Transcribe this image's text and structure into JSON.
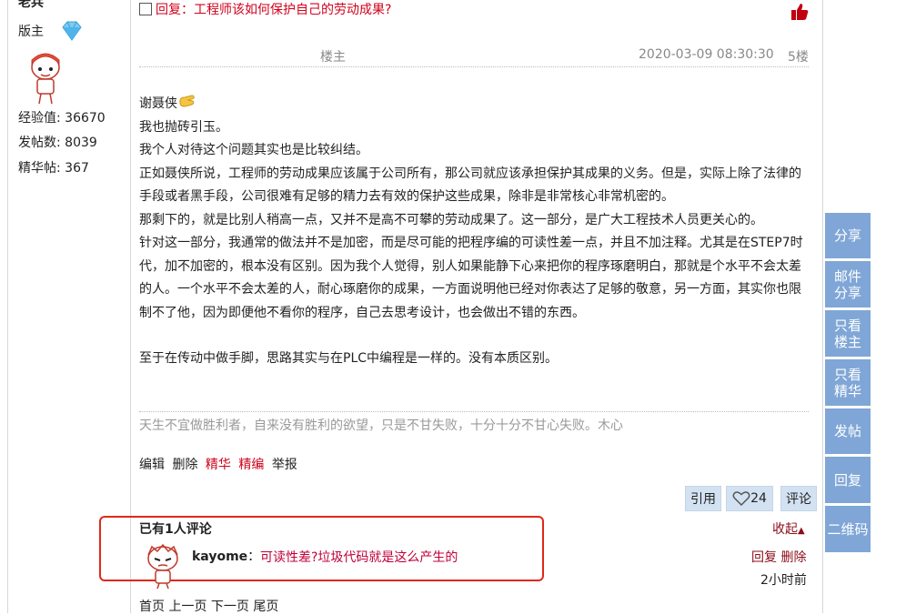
{
  "user": {
    "name": "老兵",
    "role": "版主",
    "stats": [
      {
        "label": "经验值: 36670"
      },
      {
        "label": "发帖数: 8039"
      },
      {
        "label": "精华帖: 367"
      }
    ]
  },
  "post": {
    "title": "回复：工程师该如何保护自己的劳动成果?",
    "author_tag": "楼主",
    "date": "2020-03-09 08:30:30",
    "floor": "5楼",
    "paragraphs": [
      "谢聂侠",
      "我也抛砖引玉。",
      "我个人对待这个问题其实也是比较纠结。",
      "正如聂侠所说，工程师的劳动成果应该属于公司所有，那公司就应该承担保护其成果的义务。但是，实际上除了法律的手段或者黑手段，公司很难有足够的精力去有效的保护这些成果，除非是非常核心非常机密的。",
      "那剩下的，就是比别人稍高一点，又并不是高不可攀的劳动成果了。这一部分，是广大工程技术人员更关心的。",
      "针对这一部分，我通常的做法并不是加密，而是尽可能的把程序编的可读性差一点，并且不加注释。尤其是在STEP7时代，加不加密的，根本没有区别。因为我个人觉得，别人如果能静下心来把你的程序琢磨明白，那就是个水平不会太差的人。一个水平不会太差的人，耐心琢磨你的成果，一方面说明他已经对你表达了足够的敬意，另一方面，其实你也限制不了他，因为即便他不看你的程序，自己去思考设计，也会做出不错的东西。",
      "至于在传动中做手脚，思路其实与在PLC中编程是一样的。没有本质区别。"
    ],
    "signature": "天生不宜做胜利者，自来没有胜利的欲望，只是不甘失败，十分十分不甘心失败。木心",
    "actions": {
      "edit": "编辑",
      "delete": "删除",
      "essence": "精华",
      "featured": "精编",
      "report": "举报"
    },
    "buttons": {
      "quote": "引用",
      "likes": "24",
      "comment": "评论"
    }
  },
  "comments": {
    "title": "已有1人评论",
    "collapse": "收起",
    "items": [
      {
        "user": "kayome",
        "separator": "：",
        "text": "可读性差?垃圾代码就是这么产生的",
        "reply": "回复",
        "delete": "删除",
        "time": "2小时前"
      }
    ]
  },
  "pager": {
    "first": "首页",
    "prev": "上一页",
    "next": "下一页",
    "last": "尾页"
  },
  "sidebar": {
    "share": "分享",
    "email_share": "邮件分享",
    "only_op": "只看楼主",
    "only_essence": "只看精华",
    "post": "发帖",
    "reply": "回复",
    "qrcode": "二维码"
  },
  "colors": {
    "accent_red": "#d0021b",
    "sidebar_blue": "#7fa6d6",
    "button_blue": "#d3e2f2",
    "highlight_box": "#e0281b"
  }
}
